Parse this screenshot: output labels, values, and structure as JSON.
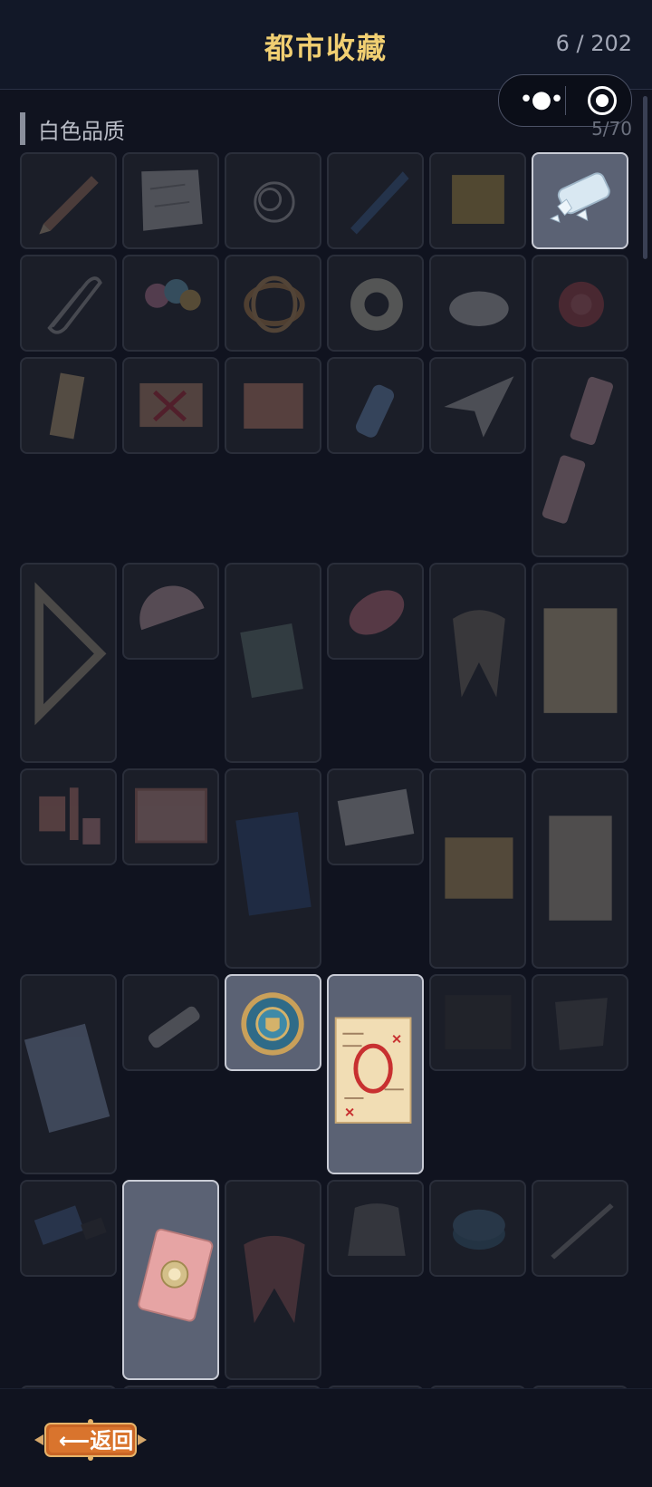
{
  "header": {
    "title": "都市收藏",
    "count": "6 / 202"
  },
  "section": {
    "title": "白色品质",
    "count": "5/70"
  },
  "colors": {
    "accent": "#f1cf72",
    "background": "#10131f",
    "owned_card": "#5b6274"
  },
  "items": [
    {
      "icon": "pencil-icon",
      "owned": false
    },
    {
      "icon": "crumpled-paper-icon",
      "owned": false
    },
    {
      "icon": "hair-tangle-icon",
      "owned": false
    },
    {
      "icon": "blue-pen-icon",
      "owned": false
    },
    {
      "icon": "sticky-note-icon",
      "owned": false
    },
    {
      "icon": "broken-glass-icon",
      "owned": true
    },
    {
      "icon": "paper-clip-icon",
      "owned": false
    },
    {
      "icon": "lollipops-icon",
      "owned": false
    },
    {
      "icon": "rubber-bands-icon",
      "owned": false
    },
    {
      "icon": "tape-roll-icon",
      "owned": false
    },
    {
      "icon": "shavings-icon",
      "owned": false
    },
    {
      "icon": "rose-icon",
      "owned": false
    },
    {
      "icon": "bookmark-icon",
      "owned": false
    },
    {
      "icon": "red-x-card-icon",
      "owned": false
    },
    {
      "icon": "card-icon",
      "owned": false
    },
    {
      "icon": "water-bottle-icon",
      "owned": false
    },
    {
      "icon": "paper-plane-icon",
      "owned": false
    },
    {
      "icon": "broken-eraser-icon",
      "owned": false
    },
    {
      "icon": "triangle-ruler-icon",
      "owned": false
    },
    {
      "icon": "protractor-icon",
      "owned": false
    },
    {
      "icon": "notebook-icon",
      "owned": false
    },
    {
      "icon": "correction-tape-icon",
      "owned": false
    },
    {
      "icon": "scarf-icon",
      "owned": false
    },
    {
      "icon": "worksheet-icon",
      "owned": false
    },
    {
      "icon": "stationery-set-icon",
      "owned": false
    },
    {
      "icon": "chalkboard-icon",
      "owned": false
    },
    {
      "icon": "blue-book-icon",
      "owned": false
    },
    {
      "icon": "envelope-icon",
      "owned": false
    },
    {
      "icon": "class-photo-icon",
      "owned": false
    },
    {
      "icon": "paper-bag-icon",
      "owned": false
    },
    {
      "icon": "ink-notebook-icon",
      "owned": false
    },
    {
      "icon": "glue-stick-icon",
      "owned": false
    },
    {
      "icon": "school-badge-icon",
      "owned": true
    },
    {
      "icon": "zero-score-test-icon",
      "owned": true
    },
    {
      "icon": "dark-photo-icon",
      "owned": false
    },
    {
      "icon": "plastic-bag-icon",
      "owned": false
    },
    {
      "icon": "usb-drive-icon",
      "owned": false
    },
    {
      "icon": "pink-diary-icon",
      "owned": true
    },
    {
      "icon": "red-scarf-icon",
      "owned": false
    },
    {
      "icon": "trash-bag-icon",
      "owned": false
    },
    {
      "icon": "coins-icon",
      "owned": false
    },
    {
      "icon": "pen-icon",
      "owned": false
    }
  ],
  "footer": {
    "back_label": "返回",
    "back_icon": "arrow-left-icon"
  }
}
